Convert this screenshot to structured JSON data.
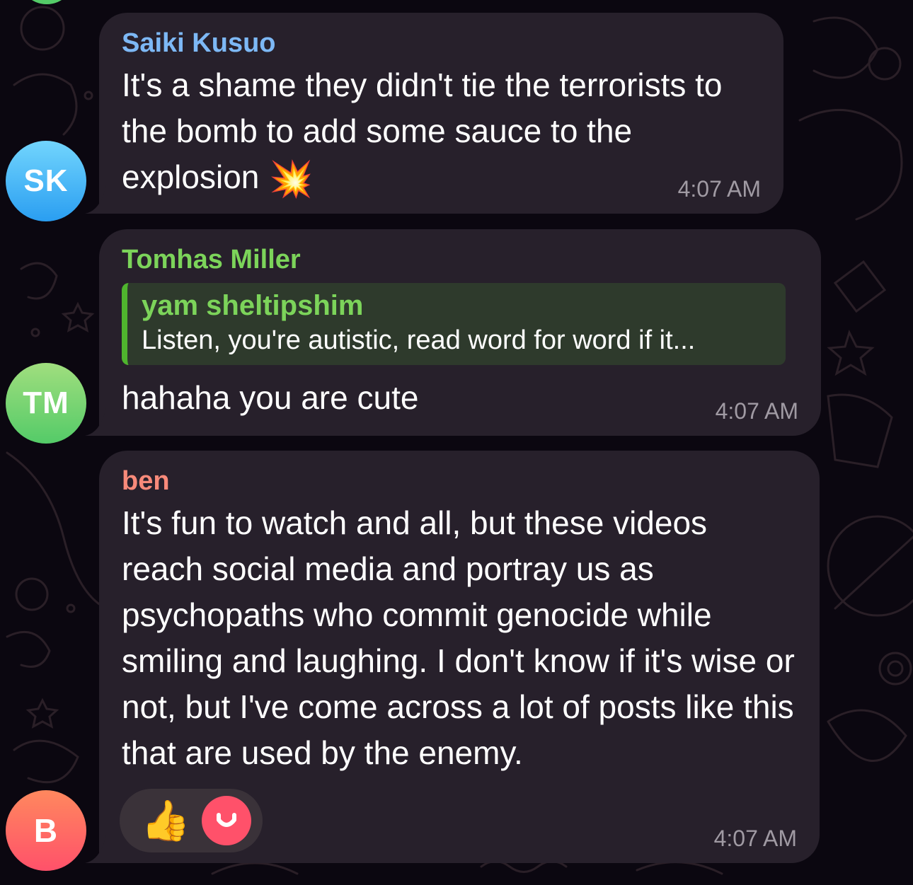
{
  "messages": [
    {
      "initials": "SK",
      "sender": "Saiki Kusuo",
      "text": "It's a shame they didn't tie the terrorists to the bomb to add some sauce to the explosion",
      "emoji": "💥",
      "time": "4:07 AM"
    },
    {
      "initials": "TM",
      "sender": "Tomhas Miller",
      "reply": {
        "name": "yam sheltipshim",
        "text": "Listen, you're autistic, read word for word if it..."
      },
      "text": "hahaha you are cute",
      "time": "4:07 AM"
    },
    {
      "initials": "B",
      "sender": "ben",
      "text": "It's fun to watch and all, but these videos reach social media and portray us as psychopaths who commit genocide while smiling and laughing. I don't know if it's wise or not, but I've come across a lot of posts like this that are used by the enemy.",
      "reactions": {
        "emoji": "👍",
        "reactor_icon": "smile-avatar-icon"
      },
      "time": "4:07 AM"
    }
  ],
  "colors": {
    "background": "#0b0710",
    "bubble": "#27202b",
    "sender_sk": "#7db8f5",
    "sender_tm": "#7cd45a",
    "sender_b": "#f88a7a",
    "timestamp": "#a09aa3"
  }
}
